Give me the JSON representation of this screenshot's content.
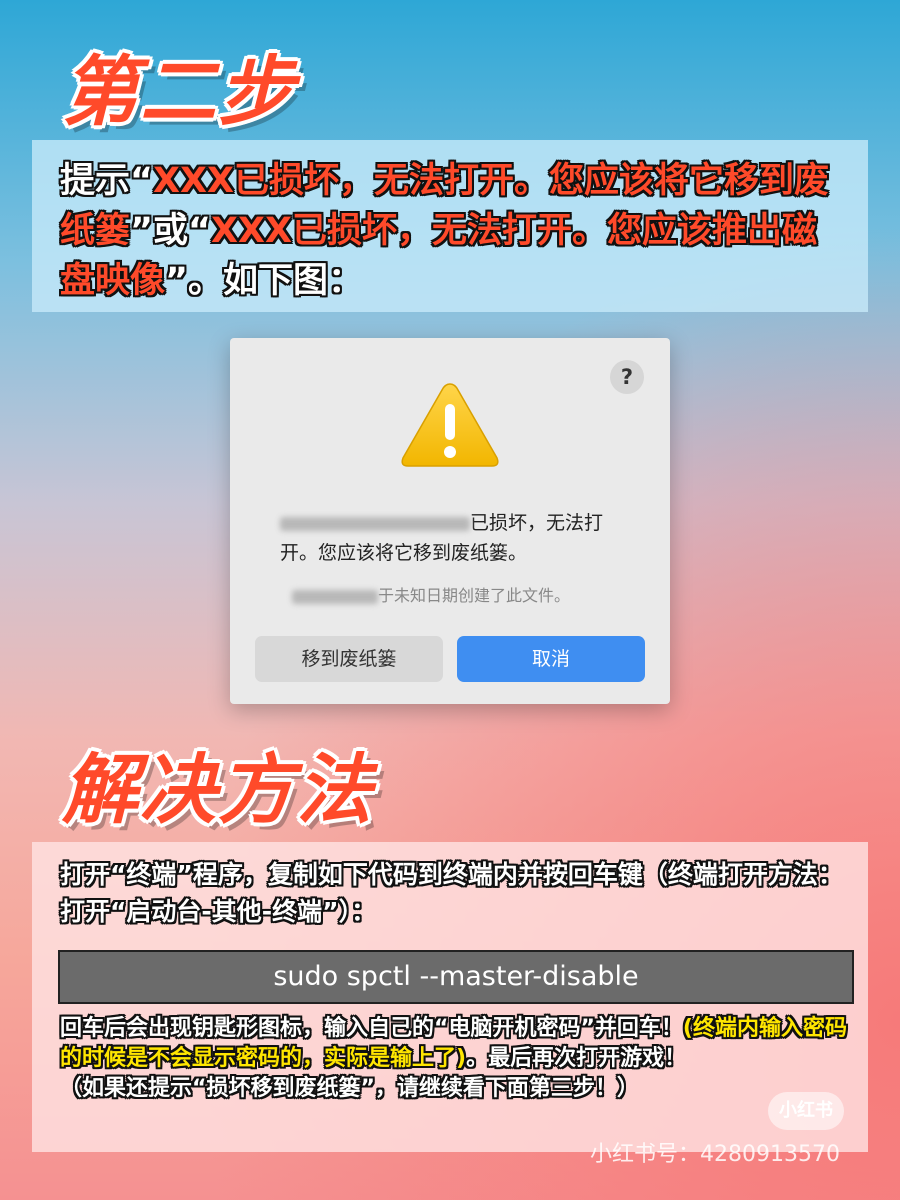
{
  "heading_step": "第二步",
  "heading_solution": "解决方法",
  "intro": {
    "t1": "提示“",
    "t2": "XXX已损坏，无法打开。您应该将它移到废纸篓",
    "t3": "”或“",
    "t4": "XXX已损坏，无法打开。您应该推出磁盘映像",
    "t5": "”。如下图："
  },
  "dialog": {
    "help_label": "?",
    "message_suffix": "已损坏，无法打",
    "message_line2": "开。您应该将它移到废纸篓。",
    "created_note": "于未知日期创建了此文件。",
    "move_to_trash": "移到废纸篓",
    "cancel": "取消",
    "icon": "warning-triangle-icon",
    "cancel_color": "#3f8ef1"
  },
  "instructions": "打开“终端”程序，复制如下代码到终端内并按回车键（终端打开方法：打开“启动台-其他-终端”）：",
  "command": "sudo spctl --master-disable",
  "after": {
    "p1": "回车后会出现钥匙形图标，输入自己的“电脑开机密码”并回车！",
    "p2": "(终端内输入密码的时候是不会显示密码的，实际是输上了)",
    "p3": "。最后再次打开游戏！",
    "p4": "（如果还提示“损坏移到废纸篓”，请继续看下面第三步！）"
  },
  "watermark": {
    "logo": "小红书",
    "id": "小红书号：4280913570"
  },
  "colors": {
    "accent_red": "#ff4a2a",
    "highlight_yellow": "#ffe600"
  }
}
